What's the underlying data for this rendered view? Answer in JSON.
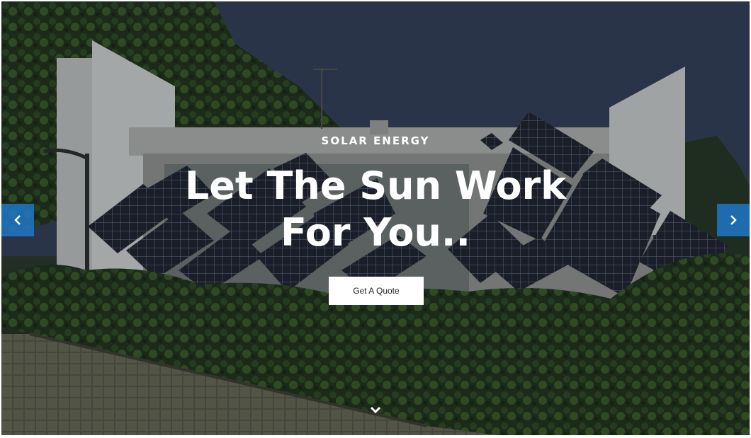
{
  "hero": {
    "eyebrow": "SOLAR ENERGY",
    "headline": "Let The Sun Work For You..",
    "cta_label": "Get A Quote"
  },
  "icons": {
    "prev": "chevron-left-icon",
    "next": "chevron-right-icon",
    "scroll": "chevron-down-icon"
  },
  "colors": {
    "slider_arrow": "#1e78c8",
    "cta_background": "#ffffff",
    "sky": "#34405a"
  }
}
